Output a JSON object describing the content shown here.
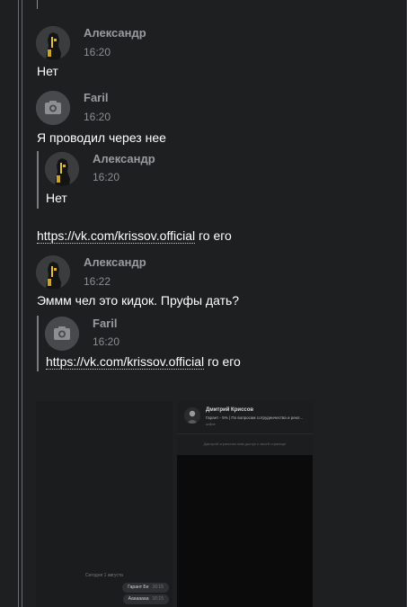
{
  "messages": [
    {
      "name": "Александр",
      "time": "16:20",
      "text": "Нет"
    },
    {
      "name": "Faril",
      "time": "16:20",
      "text": "Я проводил через нее"
    },
    {
      "name": "Александр",
      "time": "16:22",
      "text": "Эммм чел это кидок. Пруфы дать?"
    }
  ],
  "quote1": {
    "name": "Александр",
    "time": "16:20",
    "text": "Нет"
  },
  "standalone": {
    "link": "https://vk.com/krissov.official",
    "suffix": " го его"
  },
  "quote2": {
    "name": "Faril",
    "time": "16:20",
    "link": "https://vk.com/krissov.official",
    "suffix": " го его"
  },
  "attachment1": {
    "day_label": "Сегодня 1 августа",
    "bubbles": [
      {
        "text": "Гарант Бе",
        "time": "16:15"
      },
      {
        "text": "Аааааааа",
        "time": "16:15"
      }
    ]
  },
  "attachment2": {
    "profile_name": "Дмитрий Криссов",
    "status": "Гарант - 5% | По вопросам сотрудничества и рекл...",
    "extra": "online",
    "note": "Дмитрий ограничил вам доступ к своей странице"
  },
  "colors": {
    "background": "#1e1f21",
    "name": "#9a9b9e",
    "time": "#8d8e92",
    "text": "#ffffff"
  },
  "icons": {
    "faril_avatar": "camera-icon"
  }
}
